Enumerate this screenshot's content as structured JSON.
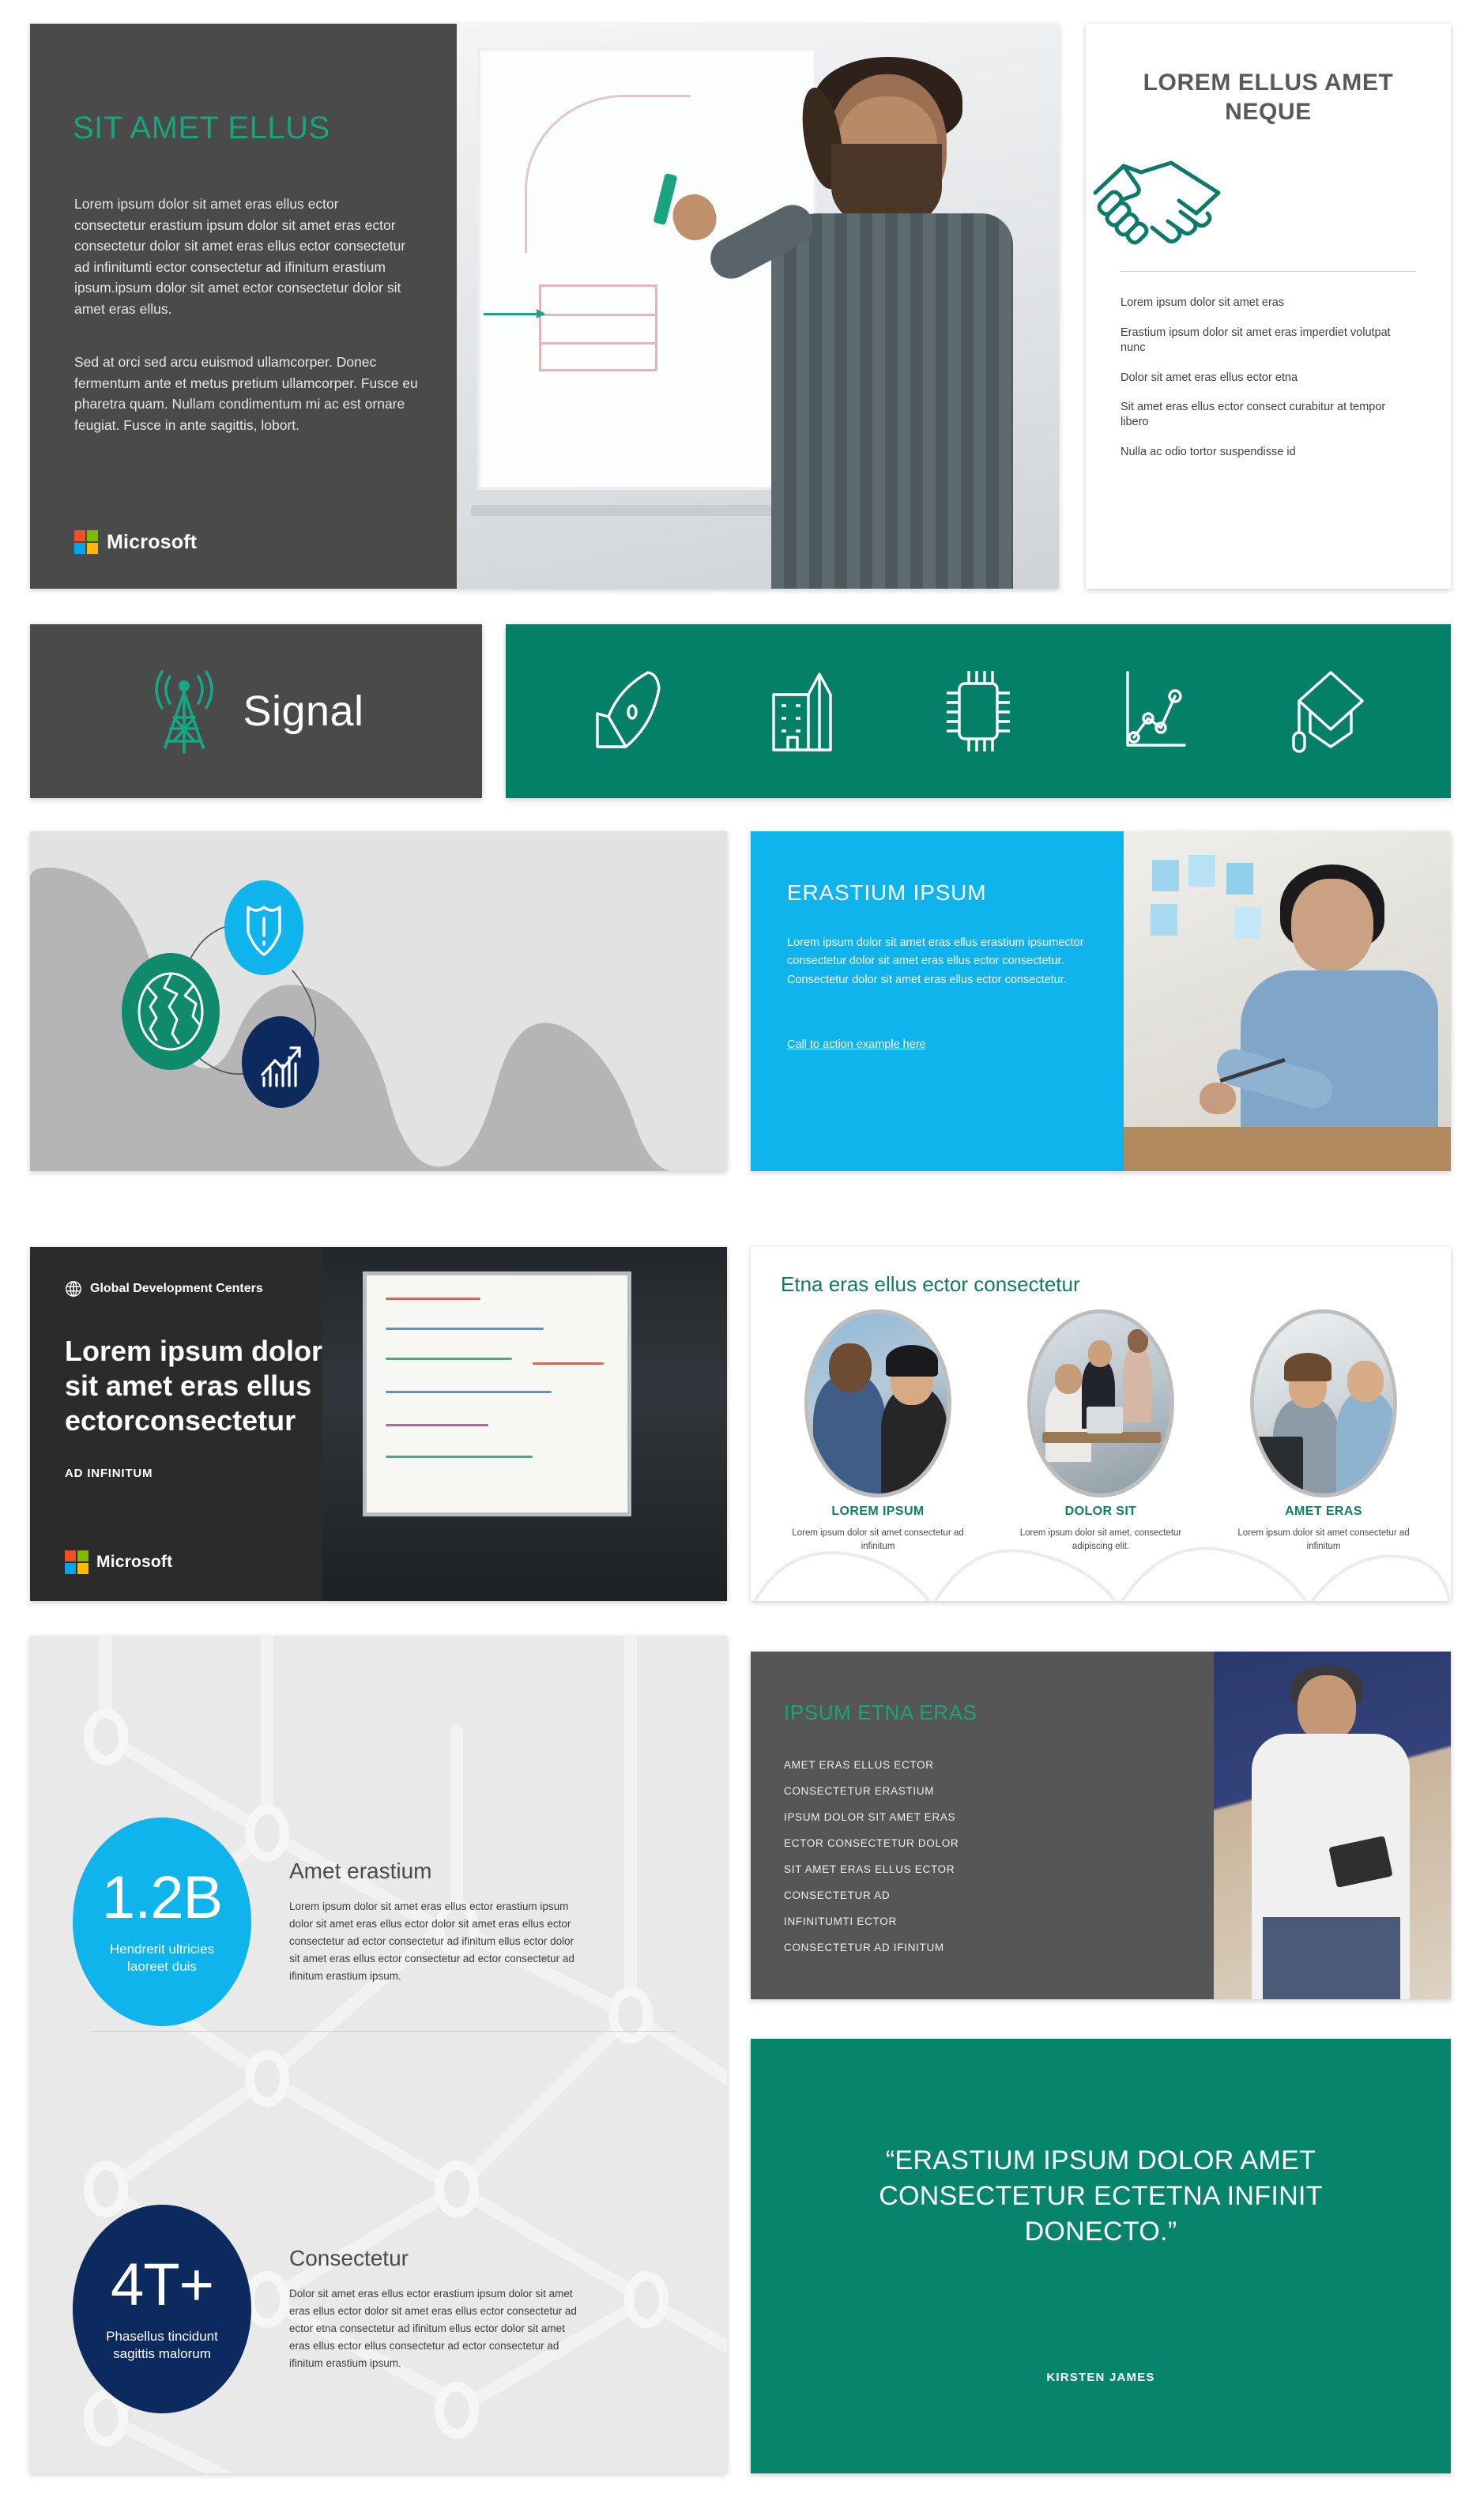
{
  "deck": {
    "brand_name": "Microsoft",
    "colors": {
      "teal": "#048069",
      "teal_accent": "#17a47e",
      "cyan": "#10b4ec",
      "navy": "#0d2a5e",
      "dark_gray": "#4a4a4a",
      "light_gray": "#e9e9e9"
    }
  },
  "slide1": {
    "title": "SIT AMET ELLUS",
    "paragraph1": "Lorem ipsum dolor sit amet eras ellus ector consectetur erastium ipsum dolor sit amet eras ector consectetur dolor sit amet eras ellus ector consectetur ad infinitumti ector consectetur ad ifinitum erastium ipsum.ipsum dolor sit amet ector consectetur dolor sit amet eras ellus.",
    "paragraph2": "Sed at orci sed arcu euismod ullamcorper. Donec fermentum ante et metus pretium ullamcorper. Fusce eu pharetra quam. Nullam condimentum mi ac est ornare feugiat. Fusce in ante sagittis, lobort.",
    "logo_label": "Microsoft",
    "image_alt": "man-writing-on-whiteboard-photo"
  },
  "slide2": {
    "title": "LOREM ELLUS AMET NEQUE",
    "icon": "handshake-icon",
    "bullets": [
      "Lorem ipsum dolor sit amet eras",
      "Erastium ipsum dolor sit amet eras imperdiet volutpat nunc",
      "Dolor sit amet eras ellus ector etna",
      "Sit amet eras ellus ector consect curabitur at tempor libero",
      "Nulla ac odio tortor suspendisse id"
    ]
  },
  "slide3": {
    "label": "Signal",
    "icon": "broadcast-tower-icon"
  },
  "slide4": {
    "icons": [
      "rocket-icon",
      "city-buildings-icon",
      "microchip-icon",
      "line-chart-icon",
      "graduation-cap-icon"
    ]
  },
  "slide5": {
    "nodes": [
      {
        "name": "shield-alert-icon",
        "color": "#10b4ec"
      },
      {
        "name": "globe-icon",
        "color": "#0f8a6c"
      },
      {
        "name": "bar-chart-growth-icon",
        "color": "#0d2a5e"
      }
    ]
  },
  "slide6": {
    "title": "ERASTIUM IPSUM",
    "body": "Lorem ipsum dolor sit amet eras ellus erastium ipsumector consectetur dolor sit amet eras ellus ector consectetur. Consectetur dolor sit amet eras ellus ector consectetur.",
    "cta": "Call to action example here",
    "image_alt": "woman-with-glasses-in-office-photo"
  },
  "slide7": {
    "eyebrow": "Global Development Centers",
    "eyebrow_icon": "globe-outline-icon",
    "headline": "Lorem ipsum dolor sit amet eras ellus ectorconsectetur",
    "subhead": "AD INFINITUM",
    "logo_label": "Microsoft",
    "image_alt": "two-men-at-whiteboard-photo"
  },
  "slide8": {
    "title": "Etna eras ellus ector consectetur",
    "columns": [
      {
        "heading": "LOREM IPSUM",
        "body": "Lorem ipsum dolor sit amet consectetur ad infinitum",
        "image_alt": "two-colleagues-talking-outdoors-photo"
      },
      {
        "heading": "DOLOR SIT",
        "body": "Lorem ipsum dolor sit amet, consectetur adipiscing elit.",
        "image_alt": "team-meeting-at-table-photo"
      },
      {
        "heading": "AMET ERAS",
        "body": "Lorem ipsum dolor sit amet consectetur ad infinitum",
        "image_alt": "two-people-at-laptop-photo"
      }
    ]
  },
  "slide9": {
    "stats": [
      {
        "number": "1.2B",
        "caption": "Hendrerit ultricies laoreet duis",
        "color": "#10b4ec",
        "heading": "Amet erastium",
        "body": "Lorem ipsum dolor sit amet eras ellus ector erastium ipsum dolor sit amet eras ellus ector dolor sit amet eras ellus ector consectetur ad ector consectetur ad ifinitum ellus ector dolor sit amet eras ellus ector consectetur ad ector consectetur ad ifinitum erastium ipsum."
      },
      {
        "number": "4T+",
        "caption": "Phasellus tincidunt sagittis malorum",
        "color": "#0d2a5e",
        "heading": "Consectetur",
        "body": "Dolor sit amet eras ellus ector erastium ipsum dolor sit amet eras ellus ector dolor sit amet eras ellus ector consectetur ad ector etna consectetur ad ifinitum ellus ector dolor sit amet eras ellus ector ellus consectetur ad ector consectetur ad ifinitum erastium ipsum."
      }
    ]
  },
  "slide10": {
    "title": "IPSUM ETNA ERAS",
    "items": [
      "AMET ERAS ELLUS ECTOR",
      "CONSECTETUR ERASTIUM",
      "IPSUM DOLOR SIT AMET ERAS",
      "ECTOR CONSECTETUR DOLOR",
      "SIT AMET ERAS ELLUS ECTOR",
      "CONSECTETUR AD",
      "INFINITUMTI ECTOR",
      "CONSECTETUR AD IFINITUM"
    ],
    "image_alt": "smiling-man-holding-tablet-photo"
  },
  "slide11": {
    "quote": "“ERASTIUM IPSUM DOLOR AMET CONSECTETUR ECTETNA INFINIT DONECTO.”",
    "attribution": "KIRSTEN JAMES"
  }
}
